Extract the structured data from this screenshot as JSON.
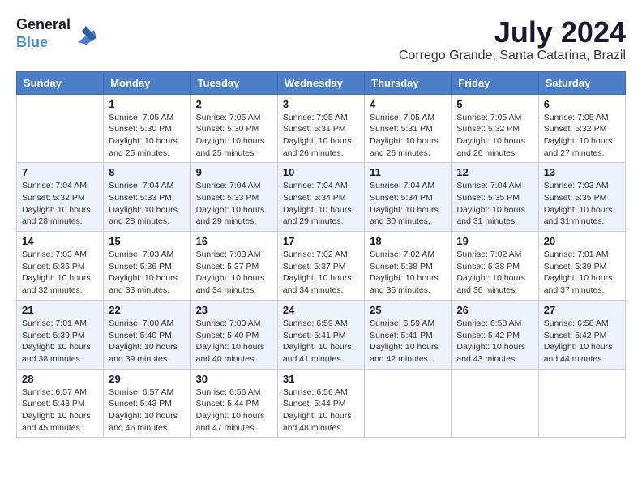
{
  "header": {
    "logo": {
      "line1": "General",
      "line2": "Blue"
    },
    "title": "July 2024",
    "location": "Corrego Grande, Santa Catarina, Brazil"
  },
  "calendar": {
    "headers": [
      "Sunday",
      "Monday",
      "Tuesday",
      "Wednesday",
      "Thursday",
      "Friday",
      "Saturday"
    ],
    "weeks": [
      [
        {
          "day": "",
          "info": ""
        },
        {
          "day": "1",
          "info": "Sunrise: 7:05 AM\nSunset: 5:30 PM\nDaylight: 10 hours\nand 25 minutes."
        },
        {
          "day": "2",
          "info": "Sunrise: 7:05 AM\nSunset: 5:30 PM\nDaylight: 10 hours\nand 25 minutes."
        },
        {
          "day": "3",
          "info": "Sunrise: 7:05 AM\nSunset: 5:31 PM\nDaylight: 10 hours\nand 26 minutes."
        },
        {
          "day": "4",
          "info": "Sunrise: 7:05 AM\nSunset: 5:31 PM\nDaylight: 10 hours\nand 26 minutes."
        },
        {
          "day": "5",
          "info": "Sunrise: 7:05 AM\nSunset: 5:32 PM\nDaylight: 10 hours\nand 26 minutes."
        },
        {
          "day": "6",
          "info": "Sunrise: 7:05 AM\nSunset: 5:32 PM\nDaylight: 10 hours\nand 27 minutes."
        }
      ],
      [
        {
          "day": "7",
          "info": "Sunrise: 7:04 AM\nSunset: 5:32 PM\nDaylight: 10 hours\nand 28 minutes."
        },
        {
          "day": "8",
          "info": "Sunrise: 7:04 AM\nSunset: 5:33 PM\nDaylight: 10 hours\nand 28 minutes."
        },
        {
          "day": "9",
          "info": "Sunrise: 7:04 AM\nSunset: 5:33 PM\nDaylight: 10 hours\nand 29 minutes."
        },
        {
          "day": "10",
          "info": "Sunrise: 7:04 AM\nSunset: 5:34 PM\nDaylight: 10 hours\nand 29 minutes."
        },
        {
          "day": "11",
          "info": "Sunrise: 7:04 AM\nSunset: 5:34 PM\nDaylight: 10 hours\nand 30 minutes."
        },
        {
          "day": "12",
          "info": "Sunrise: 7:04 AM\nSunset: 5:35 PM\nDaylight: 10 hours\nand 31 minutes."
        },
        {
          "day": "13",
          "info": "Sunrise: 7:03 AM\nSunset: 5:35 PM\nDaylight: 10 hours\nand 31 minutes."
        }
      ],
      [
        {
          "day": "14",
          "info": "Sunrise: 7:03 AM\nSunset: 5:36 PM\nDaylight: 10 hours\nand 32 minutes."
        },
        {
          "day": "15",
          "info": "Sunrise: 7:03 AM\nSunset: 5:36 PM\nDaylight: 10 hours\nand 33 minutes."
        },
        {
          "day": "16",
          "info": "Sunrise: 7:03 AM\nSunset: 5:37 PM\nDaylight: 10 hours\nand 34 minutes."
        },
        {
          "day": "17",
          "info": "Sunrise: 7:02 AM\nSunset: 5:37 PM\nDaylight: 10 hours\nand 34 minutes."
        },
        {
          "day": "18",
          "info": "Sunrise: 7:02 AM\nSunset: 5:38 PM\nDaylight: 10 hours\nand 35 minutes."
        },
        {
          "day": "19",
          "info": "Sunrise: 7:02 AM\nSunset: 5:38 PM\nDaylight: 10 hours\nand 36 minutes."
        },
        {
          "day": "20",
          "info": "Sunrise: 7:01 AM\nSunset: 5:39 PM\nDaylight: 10 hours\nand 37 minutes."
        }
      ],
      [
        {
          "day": "21",
          "info": "Sunrise: 7:01 AM\nSunset: 5:39 PM\nDaylight: 10 hours\nand 38 minutes."
        },
        {
          "day": "22",
          "info": "Sunrise: 7:00 AM\nSunset: 5:40 PM\nDaylight: 10 hours\nand 39 minutes."
        },
        {
          "day": "23",
          "info": "Sunrise: 7:00 AM\nSunset: 5:40 PM\nDaylight: 10 hours\nand 40 minutes."
        },
        {
          "day": "24",
          "info": "Sunrise: 6:59 AM\nSunset: 5:41 PM\nDaylight: 10 hours\nand 41 minutes."
        },
        {
          "day": "25",
          "info": "Sunrise: 6:59 AM\nSunset: 5:41 PM\nDaylight: 10 hours\nand 42 minutes."
        },
        {
          "day": "26",
          "info": "Sunrise: 6:58 AM\nSunset: 5:42 PM\nDaylight: 10 hours\nand 43 minutes."
        },
        {
          "day": "27",
          "info": "Sunrise: 6:58 AM\nSunset: 5:42 PM\nDaylight: 10 hours\nand 44 minutes."
        }
      ],
      [
        {
          "day": "28",
          "info": "Sunrise: 6:57 AM\nSunset: 5:43 PM\nDaylight: 10 hours\nand 45 minutes."
        },
        {
          "day": "29",
          "info": "Sunrise: 6:57 AM\nSunset: 5:43 PM\nDaylight: 10 hours\nand 46 minutes."
        },
        {
          "day": "30",
          "info": "Sunrise: 6:56 AM\nSunset: 5:44 PM\nDaylight: 10 hours\nand 47 minutes."
        },
        {
          "day": "31",
          "info": "Sunrise: 6:56 AM\nSunset: 5:44 PM\nDaylight: 10 hours\nand 48 minutes."
        },
        {
          "day": "",
          "info": ""
        },
        {
          "day": "",
          "info": ""
        },
        {
          "day": "",
          "info": ""
        }
      ]
    ]
  }
}
